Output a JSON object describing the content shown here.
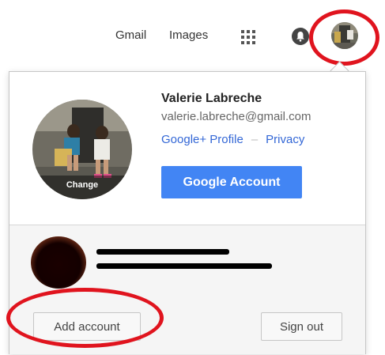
{
  "topbar": {
    "gmail_label": "Gmail",
    "images_label": "Images",
    "apps_icon": "apps-grid-icon",
    "notifications_icon": "bell-icon"
  },
  "account": {
    "name": "Valerie Labreche",
    "email": "valerie.labreche@gmail.com",
    "change_photo_label": "Change",
    "google_plus_profile_label": "Google+ Profile",
    "separator": "–",
    "privacy_label": "Privacy",
    "google_account_button": "Google Account"
  },
  "footer": {
    "add_account_label": "Add account",
    "sign_out_label": "Sign out"
  },
  "colors": {
    "accent_blue": "#4285f4",
    "link_blue": "#3367d6",
    "annotation_red": "#e0141e"
  }
}
